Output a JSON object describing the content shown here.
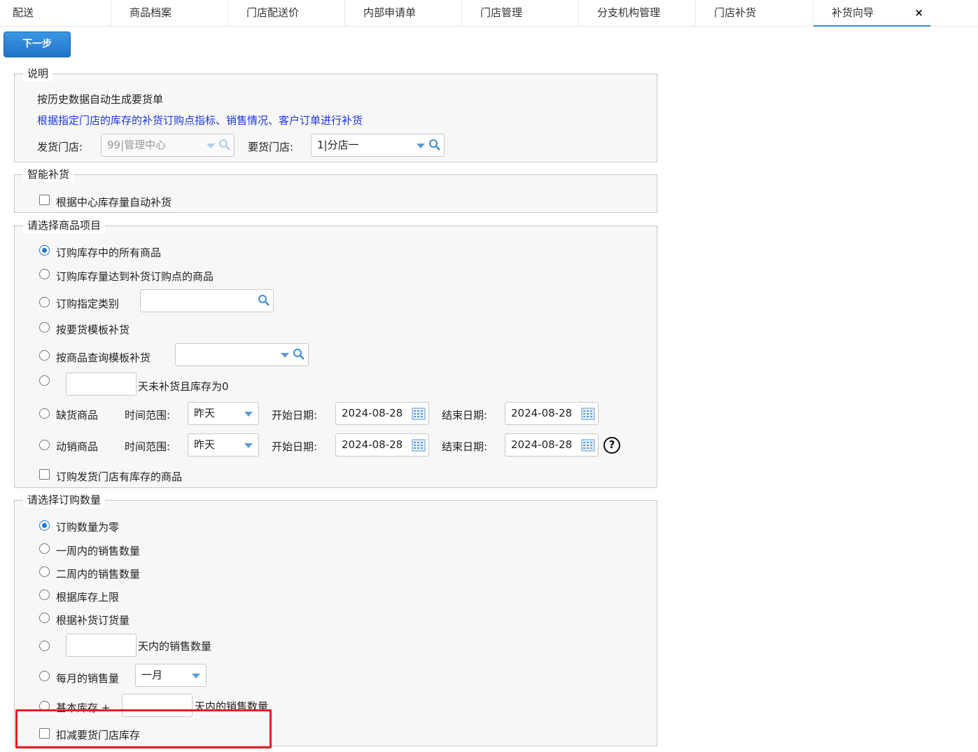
{
  "tabs": [
    "配送",
    "商品档案",
    "门店配送价",
    "内部申请单",
    "门店管理",
    "分支机构管理",
    "门店补货",
    "补货向导"
  ],
  "close_label": "×",
  "next_button": "下一步",
  "section_desc": {
    "legend": "说明",
    "line1": "按历史数据自动生成要货单",
    "line2": "根据指定门店的库存的补货订购点指标、销售情况、客户订单进行补货",
    "ship_store_label": "发货门店:",
    "ship_store_value": "99|管理中心",
    "order_store_label": "要货门店:",
    "order_store_value": "1|分店一"
  },
  "section_smart": {
    "legend": "智能补货",
    "auto_label": "根据中心库存量自动补货"
  },
  "section_items": {
    "legend": "请选择商品项目",
    "opt_all": "订购库存中的所有商品",
    "opt_reorder": "订购库存量达到补货订购点的商品",
    "opt_category": "订购指定类别",
    "opt_template": "按要货模板补货",
    "opt_query_template": "按商品查询模板补货",
    "opt_days_suffix": "天未补货且库存为0",
    "opt_shortage": "缺货商品",
    "opt_moving": "动销商品",
    "range_label": "时间范围:",
    "range_value": "昨天",
    "start_label": "开始日期:",
    "start_value": "2024-08-28",
    "end_label": "结束日期:",
    "end_value": "2024-08-28",
    "help_icon": "?",
    "ship_stock_label": "订购发货门店有库存的商品"
  },
  "section_qty": {
    "legend": "请选择订购数量",
    "opt_zero": "订购数量为零",
    "opt_week": "一周内的销售数量",
    "opt_two_week": "二周内的销售数量",
    "opt_upper": "根据库存上限",
    "opt_reorder_qty": "根据补货订货量",
    "opt_days_suffix": "天内的销售数量",
    "opt_monthly": "每月的销售量",
    "month_value": "一月",
    "opt_base": "基本库存 +",
    "opt_base_suffix": "天内的销售数量",
    "deduct_label": "扣减要货门店库存"
  },
  "colors": {
    "accent": "#1f78d1",
    "highlight": "#ec1c24",
    "link_text": "#1a35e0"
  }
}
